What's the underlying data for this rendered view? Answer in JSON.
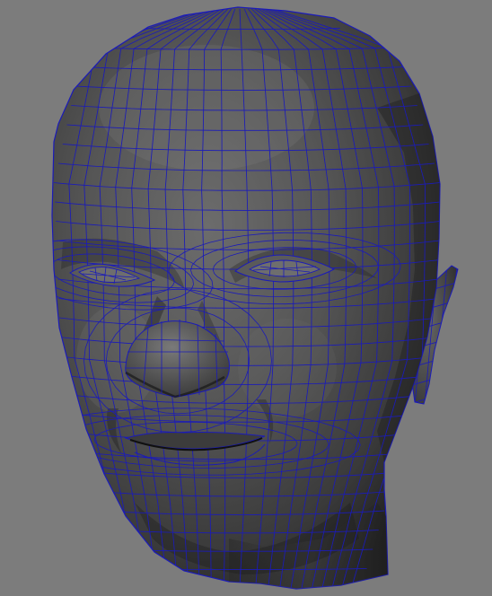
{
  "viewport": {
    "background_color": "#7c7c7c"
  },
  "model": {
    "shading": "smooth-shaded-with-wireframe",
    "surface_light": "#6a6a6a",
    "surface_mid": "#4a4a4a",
    "surface_dark": "#232323",
    "wireframe_color": "#1b1bb8"
  }
}
